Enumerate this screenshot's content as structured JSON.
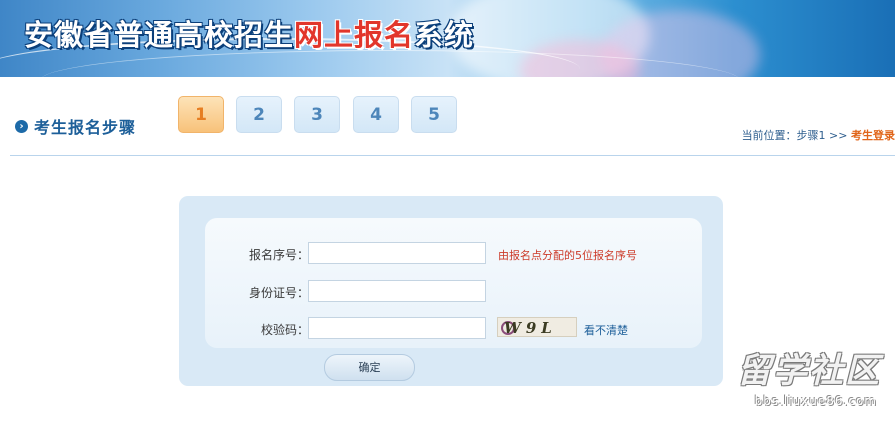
{
  "header": {
    "title_part1": "安徽省普通高校招生",
    "title_highlight": "网上报名",
    "title_part2": "系统"
  },
  "steps": {
    "title": "考生报名步骤",
    "items": [
      "1",
      "2",
      "3",
      "4",
      "5"
    ],
    "active_index": 0
  },
  "location": {
    "prefix": "当前位置：步骤1 >> ",
    "current": "考生登录"
  },
  "form": {
    "reg_label": "报名序号：",
    "reg_value": "",
    "reg_hint": "由报名点分配的5位报名序号",
    "id_label": "身份证号：",
    "id_value": "",
    "captcha_label": "校验码：",
    "captcha_value": "",
    "captcha_text": "W9L",
    "refresh_label": "看不清楚",
    "submit_label": "确定"
  },
  "watermark": {
    "text": "留学社区",
    "url": "bbs.liuxue86.com"
  },
  "colors": {
    "accent_blue": "#1d5f99",
    "active_step": "#f8c27a",
    "hint_red": "#cc3b2a",
    "current_orange": "#e0651a"
  }
}
